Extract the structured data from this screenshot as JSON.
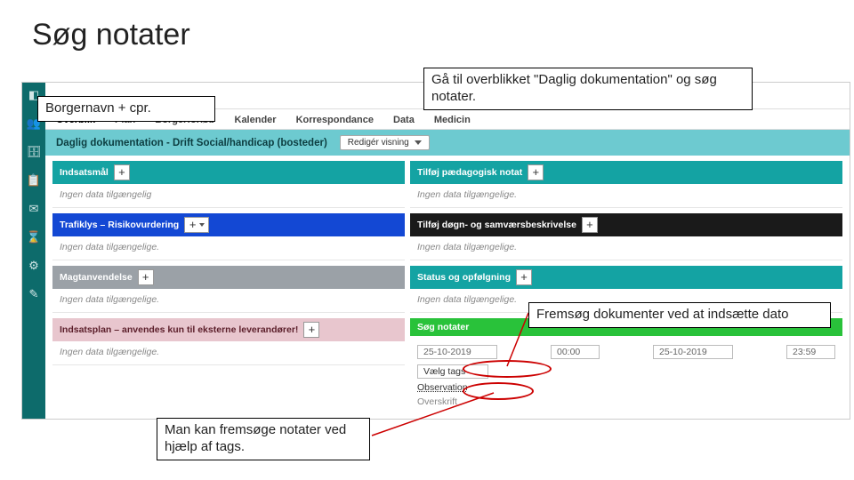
{
  "slide": {
    "title": "Søg notater"
  },
  "callouts": {
    "topLeft": "Borgernavn + cpr.",
    "topRight": "Gå til overblikket \"Daglig dokumentation\" og søg notater.",
    "right": "Fremsøg dokumenter ved at indsætte dato",
    "bottom": "Man kan fremsøge notater ved hjælp af tags."
  },
  "tabs": [
    "Overblik",
    "Plan",
    "Borgerforløb",
    "Kalender",
    "Korrespondance",
    "Data",
    "Medicin"
  ],
  "header": {
    "title": "Daglig dokumentation - Drift Social/handicap (bosteder)",
    "editBtn": "Redigér visning"
  },
  "left": {
    "c1": {
      "title": "Indsatsmål",
      "body": "Ingen data tilgængelig"
    },
    "c2": {
      "title": "Trafiklys – Risikovurdering",
      "body": "Ingen data tilgængelige."
    },
    "c3": {
      "title": "Magtanvendelse",
      "body": "Ingen data tilgængelige."
    },
    "c4": {
      "title": "Indsatsplan – anvendes kun til eksterne leverandører!",
      "body": "Ingen data tilgængelige."
    }
  },
  "right": {
    "c1": {
      "title": "Tilføj pædagogisk notat",
      "body": "Ingen data tilgængelige."
    },
    "c2": {
      "title": "Tilføj døgn- og samværsbeskrivelse",
      "body": "Ingen data tilgængelige."
    },
    "c3": {
      "title": "Status og opfølgning",
      "body": "Ingen data tilgængelige."
    },
    "search": {
      "title": "Søg notater",
      "fromDate": "25-10-2019",
      "fromTime": "00:00",
      "toDate": "25-10-2019",
      "toTime": "23:59",
      "tagsLabel": "Vælg tags",
      "filterLabel": "Observation",
      "overskrift": "Overskrift"
    }
  }
}
